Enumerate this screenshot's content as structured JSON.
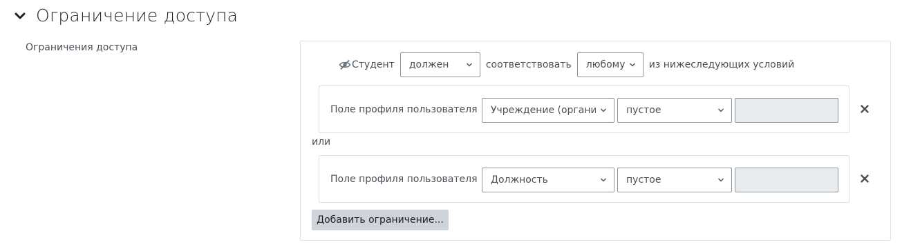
{
  "section": {
    "title": "Ограничение доступа"
  },
  "field": {
    "label": "Ограничения доступа"
  },
  "root": {
    "subject": "Студент",
    "must_select": "должен",
    "match_text": "соответствовать",
    "type_select": "любому",
    "suffix_text": "из нижеследующих условий"
  },
  "conditions": [
    {
      "label": "Поле профиля пользователя",
      "field_select": "Учреждение (организ",
      "operator_select": "пустое",
      "value": ""
    },
    {
      "label": "Поле профиля пользователя",
      "field_select": "Должность",
      "operator_select": "пустое",
      "value": ""
    }
  ],
  "connector": "или",
  "add_button": "Добавить ограничение..."
}
